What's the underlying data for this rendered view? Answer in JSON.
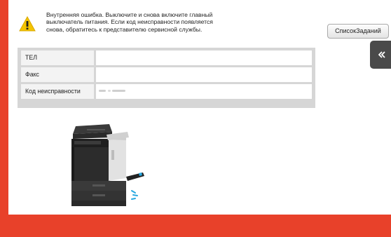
{
  "colors": {
    "frame": "#e8412a",
    "warning": "#f4c400",
    "accent": "#29a8e0"
  },
  "alert": {
    "icon": "warning-icon",
    "message": "Внутренняя ошибка. Выключите и снова включите главный\nвыключатель питания.  Если код неисправности появляется\nснова, обратитесь к представителю сервисной службы."
  },
  "toolbar": {
    "job_list_label": "СписокЗаданий"
  },
  "side_tab": {
    "icon": "double-chevron-left-icon"
  },
  "info_table": {
    "rows": [
      {
        "label": "ТЕЛ",
        "value": ""
      },
      {
        "label": "Факс",
        "value": ""
      },
      {
        "label": "Код неисправности",
        "value": ""
      }
    ]
  },
  "device": {
    "icon": "printer-device-icon"
  }
}
